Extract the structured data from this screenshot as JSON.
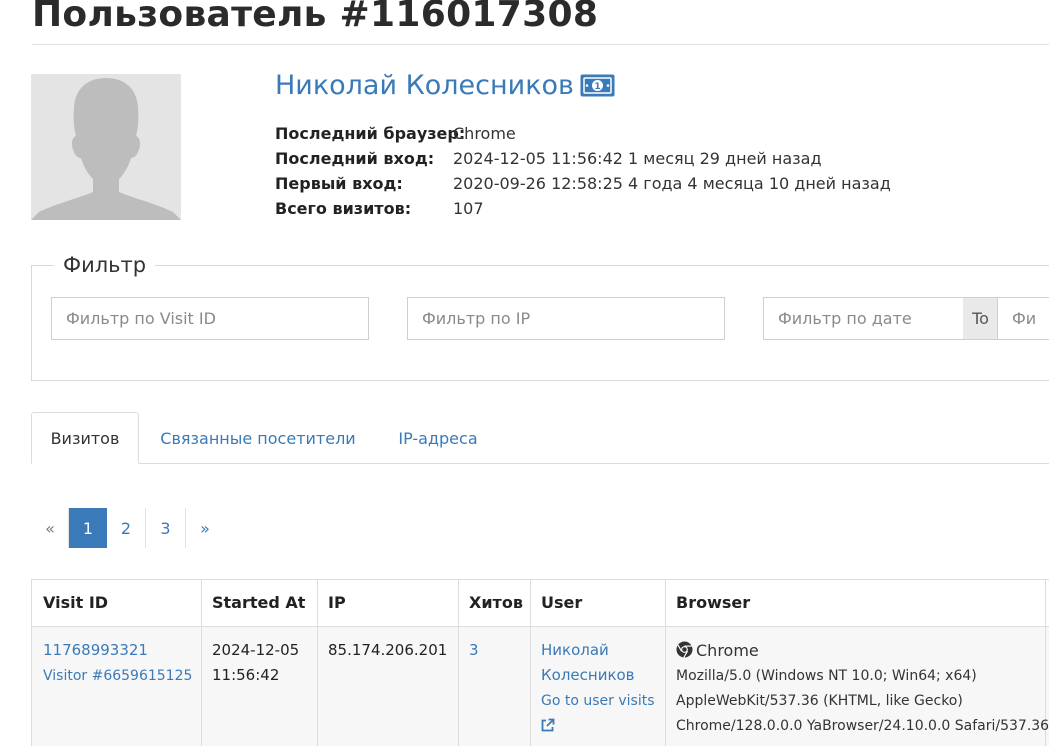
{
  "page": {
    "title": "Пользователь #116017308"
  },
  "profile": {
    "name": "Николай Колесников",
    "badge_icon": "money-icon",
    "rows": [
      {
        "label": "Последний браузер:",
        "value": "Chrome"
      },
      {
        "label": "Последний вход:",
        "value": "2024-12-05 11:56:42 1 месяц 29 дней назад"
      },
      {
        "label": "Первый вход:",
        "value": "2020-09-26 12:58:25 4 года 4 месяца 10 дней назад"
      },
      {
        "label": "Всего визитов:",
        "value": "107"
      }
    ]
  },
  "filter": {
    "legend": "Фильтр",
    "visit_id_placeholder": "Фильтр по Visit ID",
    "ip_placeholder": "Фильтр по IP",
    "date_from_placeholder": "Фильтр по дате",
    "to_label": "To",
    "date_to_placeholder": "Фильтр по дате"
  },
  "tabs": [
    {
      "label": "Визитов",
      "active": true
    },
    {
      "label": "Связанные посетители",
      "active": false
    },
    {
      "label": "IP-адреса",
      "active": false
    }
  ],
  "pagination": {
    "prev": "«",
    "pages": [
      "1",
      "2",
      "3"
    ],
    "current": "1",
    "next": "»"
  },
  "table": {
    "columns": [
      "Visit ID",
      "Started At",
      "IP",
      "Хитов",
      "User",
      "Browser"
    ],
    "rows": [
      {
        "visit_id": "11768993321",
        "visitor": "Visitor #6659615125",
        "started_date": "2024-12-05",
        "started_time": "11:56:42",
        "ip": "85.174.206.201",
        "hits": "3",
        "user_first": "Николай",
        "user_last": "Колесников",
        "go_to_visits": "Go to user visits",
        "browser_name": "Chrome",
        "ua_line1": "Mozilla/5.0 (Windows NT 10.0; Win64; x64)",
        "ua_line2": "AppleWebKit/537.36 (KHTML, like Gecko)",
        "ua_line3": "Chrome/128.0.0.0 YaBrowser/24.10.0.0 Safari/537.36"
      }
    ]
  },
  "colors": {
    "accent": "#3a7ab8",
    "avatar_bg": "#e4e4e4",
    "avatar_figure": "#bdbdbd"
  }
}
